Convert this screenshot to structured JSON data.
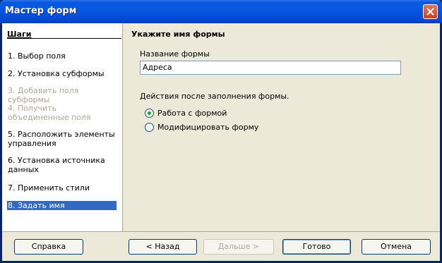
{
  "window": {
    "title": "Мастер форм"
  },
  "steps": {
    "header": "Шаги",
    "items": [
      {
        "label": "1. Выбор поля",
        "state": "normal"
      },
      {
        "label": "2. Установка субформы",
        "state": "normal"
      },
      {
        "label": "3. Добавить поля субформы",
        "state": "disabled"
      },
      {
        "label": "4. Получить объединенные поля",
        "state": "disabled"
      },
      {
        "label": "5. Расположить элементы управления",
        "state": "normal"
      },
      {
        "label": "6. Установка источника данных",
        "state": "normal"
      },
      {
        "label": "7. Применить стили",
        "state": "normal"
      },
      {
        "label": "8. Задать имя",
        "state": "selected"
      }
    ]
  },
  "main": {
    "title": "Укажите имя формы",
    "name_label": "Название формы",
    "name_value": "Адреса",
    "actions_label": "Действия после заполнения формы.",
    "options": [
      {
        "label": "Работа с формой",
        "checked": true
      },
      {
        "label": "Модифицировать форму",
        "checked": false
      }
    ]
  },
  "buttons": {
    "help": "Справка",
    "back": "< Назад",
    "next": "Дальше >",
    "finish": "Готово",
    "cancel": "Отмена"
  },
  "colors": {
    "titlebar": "#0555df",
    "selection": "#316ac5",
    "dialog_bg": "#ece9d8",
    "radio_dot": "#21a121"
  }
}
